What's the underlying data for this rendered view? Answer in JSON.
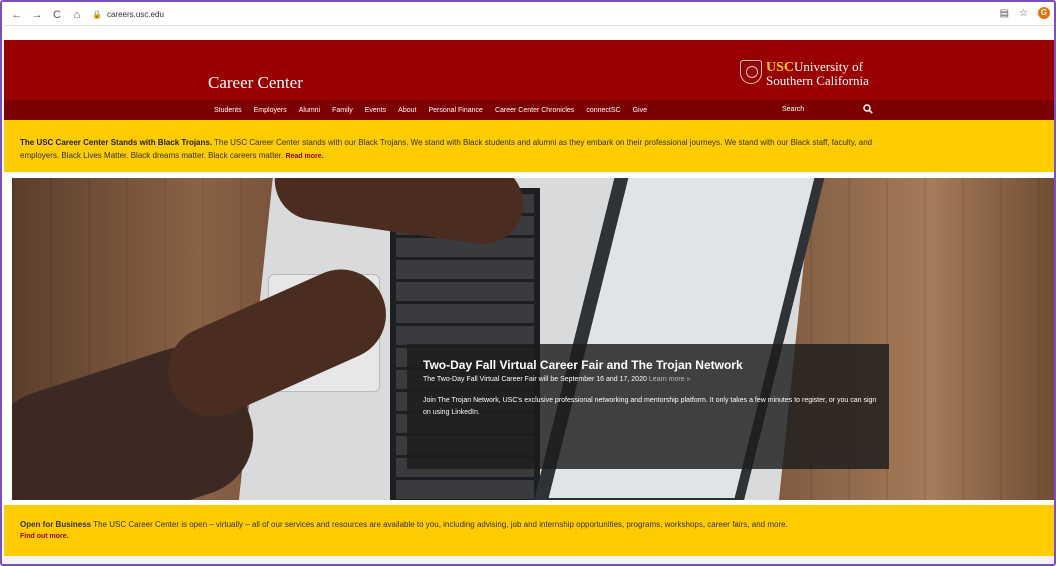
{
  "browser": {
    "back_icon": "←",
    "forward_icon": "→",
    "reload_icon": "C",
    "home_icon": "⌂",
    "lock_icon": "🔒",
    "url": "careers.usc.edu",
    "reader_icon": "▤",
    "star_icon": "☆",
    "profile_initial": "G"
  },
  "header": {
    "title": "Career Center",
    "logo_usc": "USC",
    "logo_line1": "University of",
    "logo_line2": "Southern California"
  },
  "nav": {
    "items": [
      "Students",
      "Employers",
      "Alumni",
      "Family",
      "Events",
      "About",
      "Personal Finance",
      "Career Center Chronicles",
      "connectSC",
      "Give"
    ],
    "search_label": "Search"
  },
  "alert": {
    "bold": "The USC Career Center Stands with Black Trojans.",
    "text1": " The USC Career Center stands with our Black Trojans. We stand with Black students and alumni as they embark on their professional journeys. We stand with our Black staff, faculty, and",
    "text2": "employers. Black Lives Matter. Black dreams matter. Black careers matter. ",
    "link": "Read more."
  },
  "hero": {
    "title": "Two-Day Fall Virtual Career Fair and The Trojan Network",
    "line1": "The Two-Day Fall Virtual Career Fair will be September 16 and 17, 2020 ",
    "line1_link": "Learn more »",
    "body": "Join The Trojan Network, USC's exclusive professional networking and mentorship platform. It only takes a few minutes to register, or you can sign on using LinkedIn."
  },
  "notice": {
    "bold": "Open for Business",
    "text": " The USC Career Center is open – virtually – all of our services and resources are available to you, including advising, job and internship opportunities, programs, workshops, career fairs, and more.",
    "link": "Find out more."
  },
  "colors": {
    "cardinal": "#990000",
    "gold": "#ffcc00"
  }
}
